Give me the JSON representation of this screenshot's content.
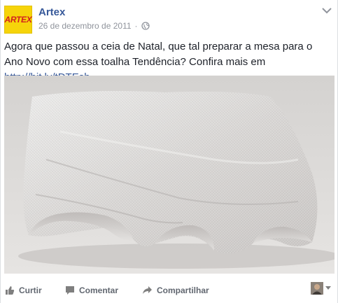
{
  "post": {
    "page_name": "Artex",
    "avatar_text": "ARTEX",
    "timestamp": "26 de dezembro de 2011",
    "separator": "·",
    "text": "Agora que passou a ceia de Natal, que tal preparar a mesa para o Ano Novo com essa toalha Tendência? Confira mais em ",
    "link": "http://bit.ly/tDTEsb",
    "photo_icon": "tablecloth-photo"
  },
  "actions": {
    "like_label": "Curtir",
    "comment_label": "Comentar",
    "share_label": "Compartilhar"
  },
  "icons": {
    "privacy": "globe-icon",
    "menu": "chevron-down-icon",
    "like": "thumbs-up-icon",
    "comment": "comment-icon",
    "share": "share-icon",
    "viewer": "viewer-avatar",
    "viewer_menu": "caret-down-icon"
  },
  "colors": {
    "link": "#365899",
    "text": "#1d2129",
    "meta": "#90949c",
    "avatar_bg": "#f6d40a",
    "avatar_text": "#d21f1f"
  }
}
